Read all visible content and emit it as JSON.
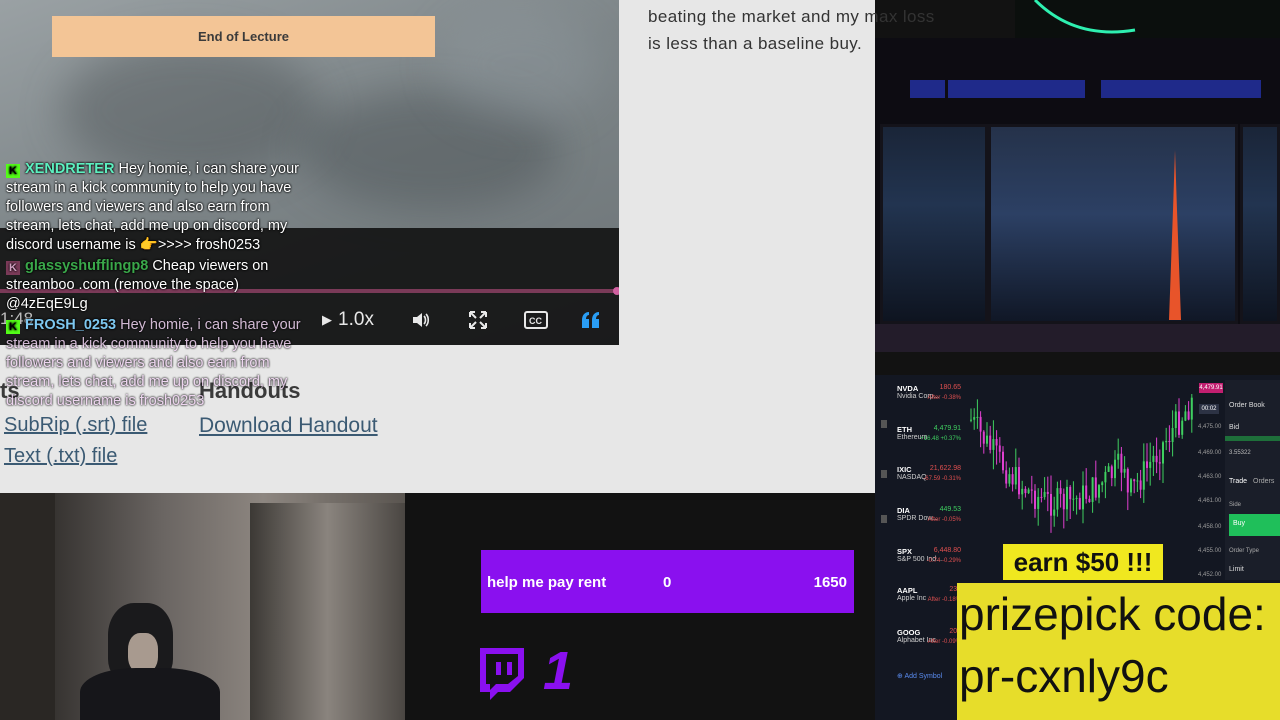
{
  "lecture": {
    "end_label": "End of Lecture",
    "time_partial": "1:48",
    "speed_label": "1.0x",
    "doc_text": "beating the market and my max loss is less than a baseline buy.",
    "handouts_title": "Handouts",
    "transcripts_title_partial": "ts",
    "download_handout": "Download Handout",
    "srt_file": "SubRip (.srt) file",
    "txt_file": "Text (.txt) file"
  },
  "chat": [
    {
      "user": "XENDRETER",
      "message": "Hey homie, i can share your stream in a kick community to help you have followers and viewers and also earn from stream, lets chat, add me up on discord, my discord username is 👉>>>> frosh0253"
    },
    {
      "user": "glassyshufflingp8",
      "message": "Cheap viewers on streamboo .com (remove the space) @4zEqE9Lg"
    },
    {
      "user": "FROSH_0253",
      "message": "Hey homie, i can share your stream in a kick community to help you have followers and viewers and also earn from stream, lets chat, add me up on discord, my discord username is frosh0253"
    }
  ],
  "goal": {
    "label": "help me pay rent",
    "current": "0",
    "target": "1650",
    "progress": 0
  },
  "twitch": {
    "count": "1"
  },
  "promo": {
    "earn_label": "earn $50 !!!",
    "prize_line1": "prizepick code:",
    "prize_line2": "pr-cxnly9c"
  },
  "trading": {
    "tickers": [
      {
        "symbol": "NVDA",
        "name": "Nvidia Corp...",
        "price": "180.65",
        "change": "After -0.38%"
      },
      {
        "symbol": "ETH",
        "name": "Ethereum",
        "price": "4,479.91",
        "change": "+16.48 +0.37%"
      },
      {
        "symbol": "IXIC",
        "name": "NASDAQ",
        "price": "21,622.98",
        "change": "-67.59 -0.31%"
      },
      {
        "symbol": "DIA",
        "name": "SPDR Dow...",
        "price": "449.53",
        "change": "After -0.05%"
      },
      {
        "symbol": "SPX",
        "name": "S&P 500 Ind...",
        "price": "6,448.80",
        "change": "-0.74 -0.29%"
      },
      {
        "symbol": "AAPL",
        "name": "Apple Inc",
        "price": "231",
        "change": "After -0.18%"
      },
      {
        "symbol": "GOOG",
        "name": "Alphabet Inc",
        "price": "204",
        "change": "After -0.09%"
      }
    ],
    "add_symbol": "Add Symbol",
    "price_badge": "4,479.91",
    "axis_prices": [
      "4,475.00",
      "4,469.00",
      "4,463.00",
      "4,461.00",
      "4,458.00",
      "4,455.00",
      "4,452.00"
    ],
    "order_book": "Order Book",
    "bid": "Bid",
    "bid_value": "3.55322",
    "trade_tab": "Trade",
    "orders_tab": "Orders",
    "side_label": "Side",
    "buy_label": "Buy",
    "order_type_label": "Order Type",
    "limit_label": "Limit"
  }
}
